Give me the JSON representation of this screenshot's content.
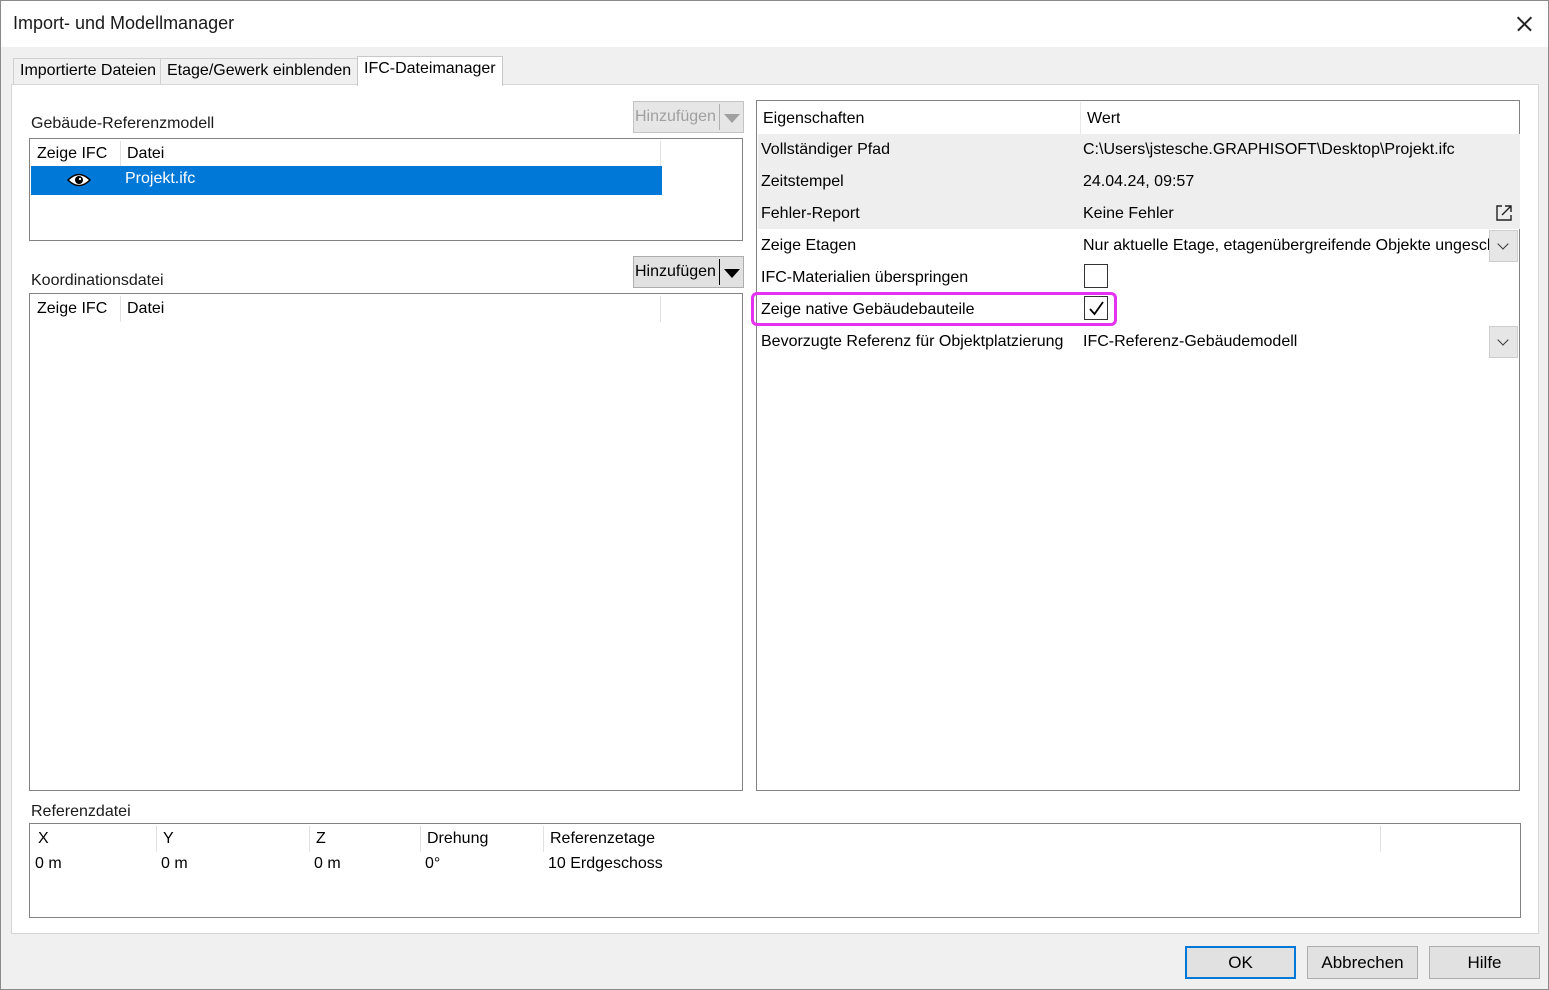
{
  "window": {
    "title": "Import- und Modellmanager"
  },
  "tabs": [
    {
      "label": "Importierte Dateien"
    },
    {
      "label": "Etage/Gewerk einblenden"
    },
    {
      "label": "IFC-Dateimanager"
    }
  ],
  "building_reference": {
    "label": "Gebäude-Referenzmodell",
    "add_button": "Hinzufügen",
    "columns": [
      "Zeige IFC",
      "Datei"
    ],
    "rows": [
      {
        "file": "Projekt.ifc",
        "visible": true,
        "selected": true
      }
    ]
  },
  "coordination": {
    "label": "Koordinationsdatei",
    "add_button": "Hinzufügen",
    "columns": [
      "Zeige IFC",
      "Datei"
    ],
    "rows": []
  },
  "properties": {
    "headers": {
      "property": "Eigenschaften",
      "value": "Wert"
    },
    "rows": [
      {
        "label": "Vollständiger Pfad",
        "value": "C:\\Users\\jstesche.GRAPHISOFT\\Desktop\\Projekt.ifc"
      },
      {
        "label": "Zeitstempel",
        "value": "24.04.24, 09:57"
      },
      {
        "label": "Fehler-Report",
        "value": "Keine Fehler",
        "icon": "open-external-icon"
      },
      {
        "label": "Zeige Etagen",
        "value": "Nur aktuelle Etage, etagenübergreifende Objekte ungesch",
        "control": "dropdown"
      },
      {
        "label": "IFC-Materialien überspringen",
        "checked": false,
        "control": "checkbox"
      },
      {
        "label": "Zeige native Gebäudebauteile",
        "checked": true,
        "control": "checkbox",
        "highlighted": true
      },
      {
        "label": "Bevorzugte Referenz für Objektplatzierung",
        "value": "IFC-Referenz-Gebäudemodell",
        "control": "dropdown"
      }
    ]
  },
  "reference_file": {
    "label": "Referenzdatei",
    "columns": [
      "X",
      "Y",
      "Z",
      "Drehung",
      "Referenzetage"
    ],
    "values": [
      "0 m",
      "0 m",
      "0 m",
      "0°",
      "10 Erdgeschoss"
    ]
  },
  "buttons": {
    "ok": "OK",
    "cancel": "Abbrechen",
    "help": "Hilfe"
  },
  "colors": {
    "selection": "#0078d7",
    "highlight": "#e532f0",
    "default_button_border": "#0078d7"
  }
}
